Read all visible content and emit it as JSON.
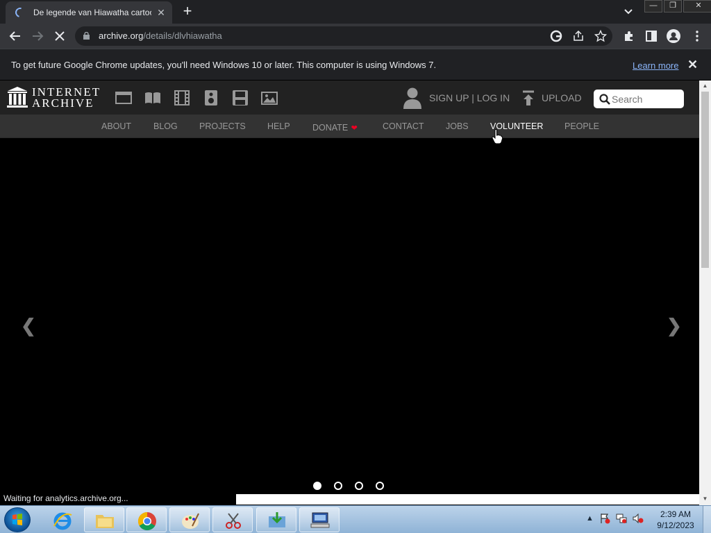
{
  "browser": {
    "tab_title": "De legende van Hiawatha cartoon",
    "url_host": "archive.org",
    "url_path": "/details/dlvhiawatha",
    "infobar_message": "To get future Google Chrome updates, you'll need Windows 10 or later. This computer is using Windows 7.",
    "infobar_link": "Learn more",
    "status": "Waiting for analytics.archive.org..."
  },
  "ia": {
    "logo_line1": "INTERNET",
    "logo_line2": "ARCHIVE",
    "signup": "SIGN UP | LOG IN",
    "upload": "UPLOAD",
    "search_placeholder": "Search",
    "nav": {
      "about": "ABOUT",
      "blog": "BLOG",
      "projects": "PROJECTS",
      "help": "HELP",
      "donate": "DONATE",
      "contact": "CONTACT",
      "jobs": "JOBS",
      "volunteer": "VOLUNTEER",
      "people": "PEOPLE"
    },
    "carousel": {
      "slides": 4,
      "active": 1
    }
  },
  "taskbar": {
    "time": "2:39 AM",
    "date": "9/12/2023"
  },
  "colors": {
    "chrome_dark": "#202124",
    "chrome_toolbar": "#35363a",
    "link_blue": "#8ab4f8",
    "ia_header": "#222222",
    "ia_nav": "#333333"
  }
}
